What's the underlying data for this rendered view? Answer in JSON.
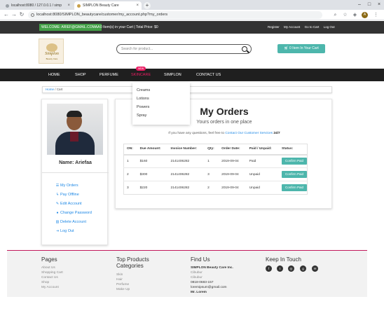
{
  "browser": {
    "tabs": [
      {
        "label": "localhost:8080 / 127.0.0.1 / simp"
      },
      {
        "label": "SIMPLON Beauty Care"
      }
    ],
    "url": "localhost:8080/SIMPLON_beautycare/customer/my_account.php?my_orders",
    "profile_initial": "A"
  },
  "topbar": {
    "welcome": "WELCOME: ARIEF@GMAIL.COMAA",
    "cart_info": "0 Item(s) in your Cart | Total Price: $0",
    "links": [
      "Register",
      "My Account",
      "Go to Cart",
      "Log Out"
    ]
  },
  "header": {
    "logo_text": "Simplon",
    "logo_sub": "Beauty Care",
    "search_placeholder": "Search for product...",
    "cart_button": "0 Item In Your Cart"
  },
  "nav": {
    "items": [
      "HOME",
      "SHOP",
      "PERFUME",
      "SKINCARE",
      "SIMPLON",
      "CONTACT US"
    ],
    "active": "SKINCARE",
    "badge": "NEW",
    "dropdown": [
      "Creams",
      "Lotions",
      "Powers",
      "Spray"
    ]
  },
  "breadcrumb": {
    "home": "Home",
    "current": "Cart",
    "separator": "/"
  },
  "sidebar": {
    "name": "Name: Ariefaa",
    "menu": [
      {
        "label": "My Orders",
        "icon": "list-icon"
      },
      {
        "label": "Pay Offline",
        "icon": "bolt-icon"
      },
      {
        "label": "Edit Account",
        "icon": "pencil-icon"
      },
      {
        "label": "Change Password",
        "icon": "user-icon"
      },
      {
        "label": "Delete Account",
        "icon": "trash-icon"
      },
      {
        "label": "Log Out",
        "icon": "logout-icon"
      }
    ]
  },
  "orders": {
    "title": "My Orders",
    "subtitle": "Yours orders in one place",
    "note_prefix": "If you have any questions, feel free to",
    "note_link": "Contact Our Customer Services",
    "note_suffix": "24/7",
    "columns": [
      "ON:",
      "Due Amount:",
      "Invoice Number:",
      "Qty:",
      "Order Date:",
      "Paid / Unpaid:",
      "Status:"
    ],
    "rows": [
      {
        "on": "1",
        "due": "$160",
        "invoice": "2141406282",
        "qty": "1",
        "date": "2019-09-04",
        "paid": "Paid",
        "status": "Confirm Paid"
      },
      {
        "on": "2",
        "due": "$300",
        "invoice": "2141406282",
        "qty": "3",
        "date": "2019-09-04",
        "paid": "Unpaid",
        "status": "Confirm Paid"
      },
      {
        "on": "3",
        "due": "$220",
        "invoice": "2141406282",
        "qty": "2",
        "date": "2019-09-04",
        "paid": "Unpaid",
        "status": "Confirm Paid"
      }
    ]
  },
  "footer": {
    "pages": {
      "title": "Pages",
      "items": [
        "About Us",
        "Shopping Cart",
        "Contact Us",
        "Shop",
        "My Account"
      ]
    },
    "top_products": {
      "title": "Top Products Categories",
      "items": [
        "Skin",
        "Hair",
        "Perfume",
        "Make Up"
      ]
    },
    "find_us": {
      "title": "Find Us",
      "lines": [
        "SIMPLON Beauty Care Inc.",
        "Cibubur",
        "Cibubur",
        "0818-0683-157",
        "loremipsum@gmail.com",
        "Mr. Lorem"
      ]
    },
    "keep_in_touch": {
      "title": "Keep In Touch",
      "social": [
        "facebook-icon",
        "twitter-icon",
        "instagram-icon",
        "google-plus-icon",
        "email-icon"
      ]
    }
  },
  "colors": {
    "accent": "#4db6ac",
    "nav_bg": "#1f1f1f",
    "topbar_bg": "#333333",
    "welcome_green": "#43a047",
    "active_pink": "#e91e63",
    "link_blue": "#1e88e5"
  }
}
